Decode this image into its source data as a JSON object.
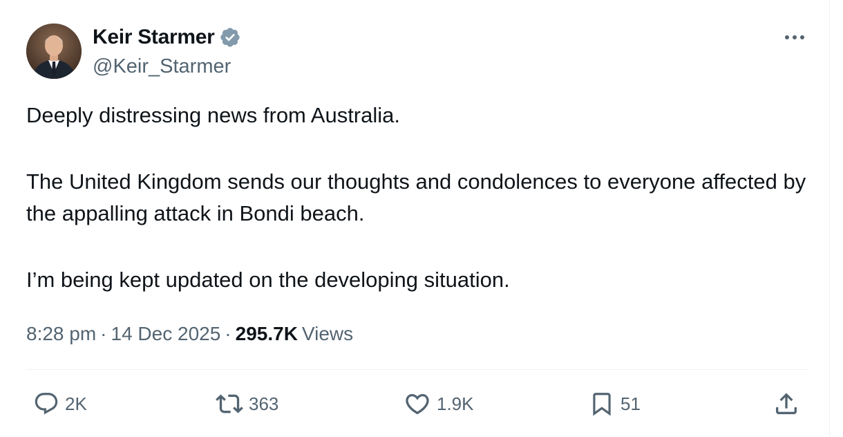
{
  "author": {
    "display_name": "Keir Starmer",
    "handle": "@Keir_Starmer",
    "verified": true,
    "avatar_icon": "profile-photo"
  },
  "tweet": {
    "paragraphs": [
      "Deeply distressing news from Australia.",
      "The United Kingdom sends our thoughts and condolences to everyone affected by the appalling attack in Bondi beach.",
      "I’m being kept updated on the developing situation."
    ]
  },
  "meta": {
    "time": "8:28 pm",
    "separator": "·",
    "date": "14 Dec 2025",
    "views_count": "295.7K",
    "views_label": "Views"
  },
  "actions": {
    "replies": "2K",
    "reposts": "363",
    "likes": "1.9K",
    "bookmarks": "51"
  },
  "colors": {
    "text_primary": "#0f1419",
    "text_secondary": "#536471",
    "verified_badge": "#829aab",
    "divider": "#eff3f4"
  }
}
